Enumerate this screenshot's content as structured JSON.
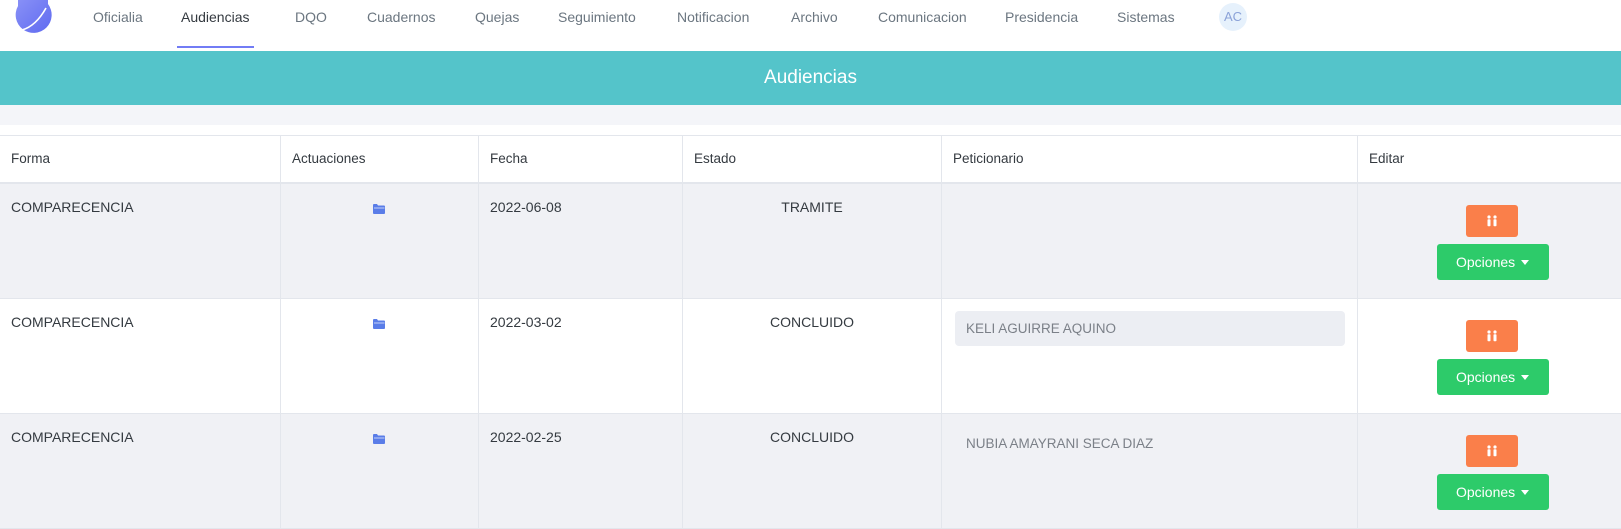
{
  "nav": {
    "items": [
      {
        "label": "Oficialia",
        "active": false
      },
      {
        "label": "Audiencias",
        "active": true
      },
      {
        "label": "DQO",
        "active": false
      },
      {
        "label": "Cuadernos",
        "active": false
      },
      {
        "label": "Quejas",
        "active": false
      },
      {
        "label": "Seguimiento",
        "active": false
      },
      {
        "label": "Notificacion",
        "active": false
      },
      {
        "label": "Archivo",
        "active": false
      },
      {
        "label": "Comunicacion",
        "active": false
      },
      {
        "label": "Presidencia",
        "active": false
      },
      {
        "label": "Sistemas",
        "active": false
      }
    ],
    "avatar_initials": "AC"
  },
  "banner": {
    "title": "Audiencias"
  },
  "table": {
    "columns": [
      "Forma",
      "Actuaciones",
      "Fecha",
      "Estado",
      "Peticionario",
      "Editar"
    ],
    "rows": [
      {
        "forma": "COMPARECENCIA",
        "actuaciones_icon": "folder-icon",
        "fecha": "2022-06-08",
        "estado": "TRAMITE",
        "peticionario": "",
        "editar_icon": "people-icon",
        "opciones_label": "Opciones"
      },
      {
        "forma": "COMPARECENCIA",
        "actuaciones_icon": "folder-icon",
        "fecha": "2022-03-02",
        "estado": "CONCLUIDO",
        "peticionario": "KELI AGUIRRE AQUINO",
        "editar_icon": "people-icon",
        "opciones_label": "Opciones"
      },
      {
        "forma": "COMPARECENCIA",
        "actuaciones_icon": "folder-icon",
        "fecha": "2022-02-25",
        "estado": "CONCLUIDO",
        "peticionario": "NUBIA AMAYRANI SECA DIAZ",
        "editar_icon": "people-icon",
        "opciones_label": "Opciones"
      }
    ]
  },
  "colors": {
    "accent": "#727cf5",
    "banner": "#54c4ca",
    "orange_button": "#fa7f4a",
    "green_button": "#2dcb6a",
    "folder_icon": "#5a7de8"
  }
}
